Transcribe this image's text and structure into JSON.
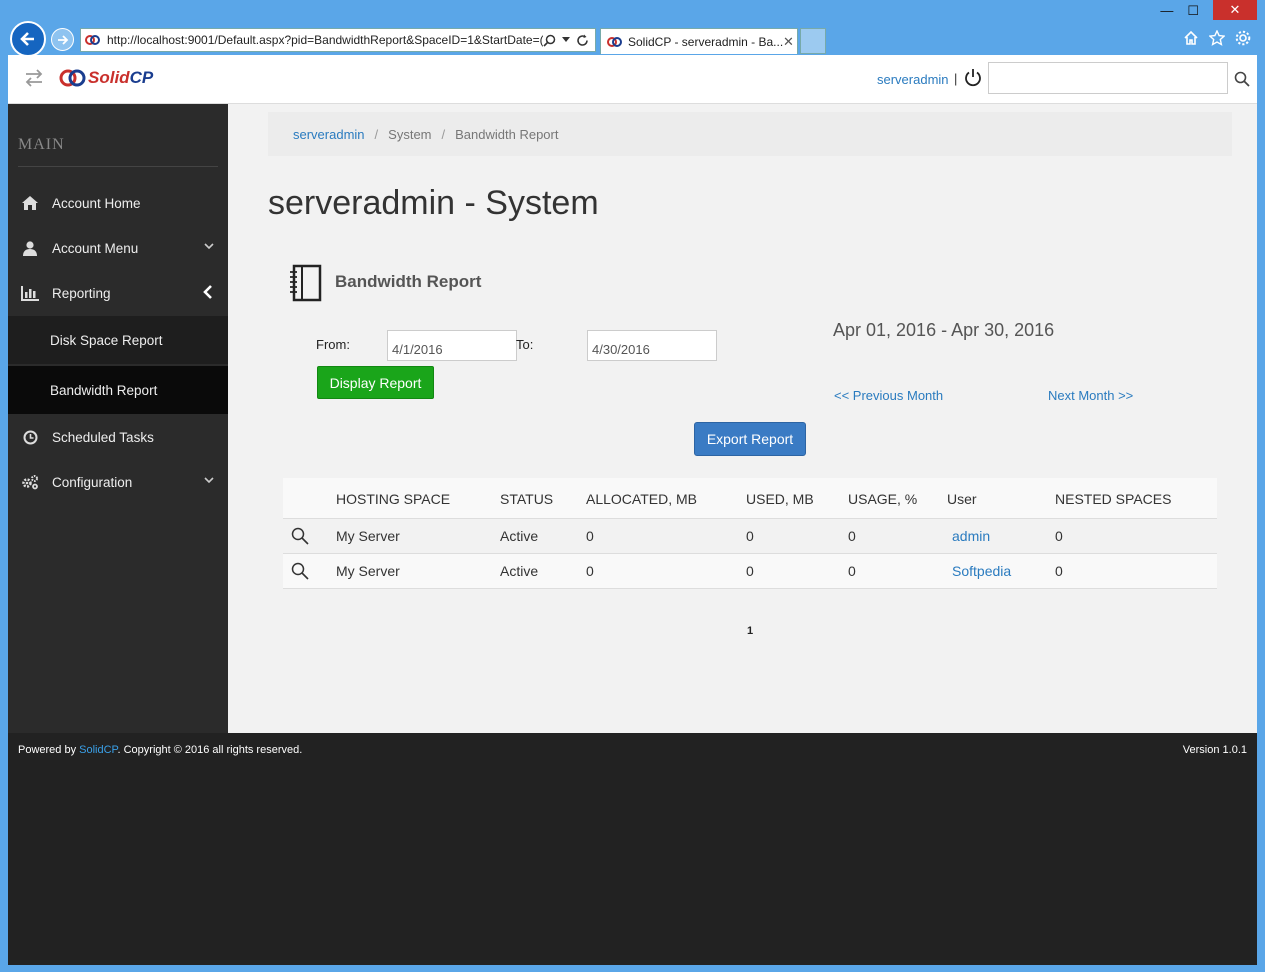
{
  "browser": {
    "url": "http://localhost:9001/Default.aspx?pid=BandwidthReport&SpaceID=1&StartDate=(",
    "tab_title": "SolidCP - serveradmin - Ba...",
    "tab_close": "✕",
    "min": "—",
    "max": "☐",
    "close": "✕"
  },
  "header": {
    "logo_solid": "Solid",
    "logo_cp": "CP",
    "user": "serveradmin",
    "separator": "|",
    "search_value": ""
  },
  "sidebar": {
    "title": "MAIN",
    "items": [
      {
        "label": "Account Home"
      },
      {
        "label": "Account Menu"
      },
      {
        "label": "Reporting"
      },
      {
        "label": "Disk Space Report"
      },
      {
        "label": "Bandwidth Report"
      },
      {
        "label": "Scheduled Tasks"
      },
      {
        "label": "Configuration"
      }
    ]
  },
  "breadcrumb": {
    "items": [
      "serveradmin",
      "System",
      "Bandwidth Report"
    ],
    "sep": "/"
  },
  "page": {
    "title": "serveradmin - System",
    "report_title": "Bandwidth Report",
    "from_label": "From:",
    "to_label": "To:",
    "from_value": "4/1/2016",
    "to_value": "4/30/2016",
    "display_button": "Display Report",
    "range": "Apr 01, 2016 - Apr 30, 2016",
    "prev_month": "<< Previous Month",
    "next_month": "Next Month >>",
    "export_button": "Export Report"
  },
  "table": {
    "columns": [
      "HOSTING SPACE",
      "STATUS",
      "ALLOCATED, MB",
      "USED, MB",
      "USAGE, %",
      "User",
      "NESTED SPACES"
    ],
    "rows": [
      [
        "My Server",
        "Active",
        "0",
        "0",
        "0",
        "admin",
        "0"
      ],
      [
        "My Server",
        "Active",
        "0",
        "0",
        "0",
        "Softpedia",
        "0"
      ]
    ],
    "page": "1"
  },
  "footer": {
    "powered_prefix": "Powered by ",
    "brand": "SolidCP",
    "powered_suffix": ". Copyright © 2016 all rights reserved.",
    "version": "Version 1.0.1"
  }
}
